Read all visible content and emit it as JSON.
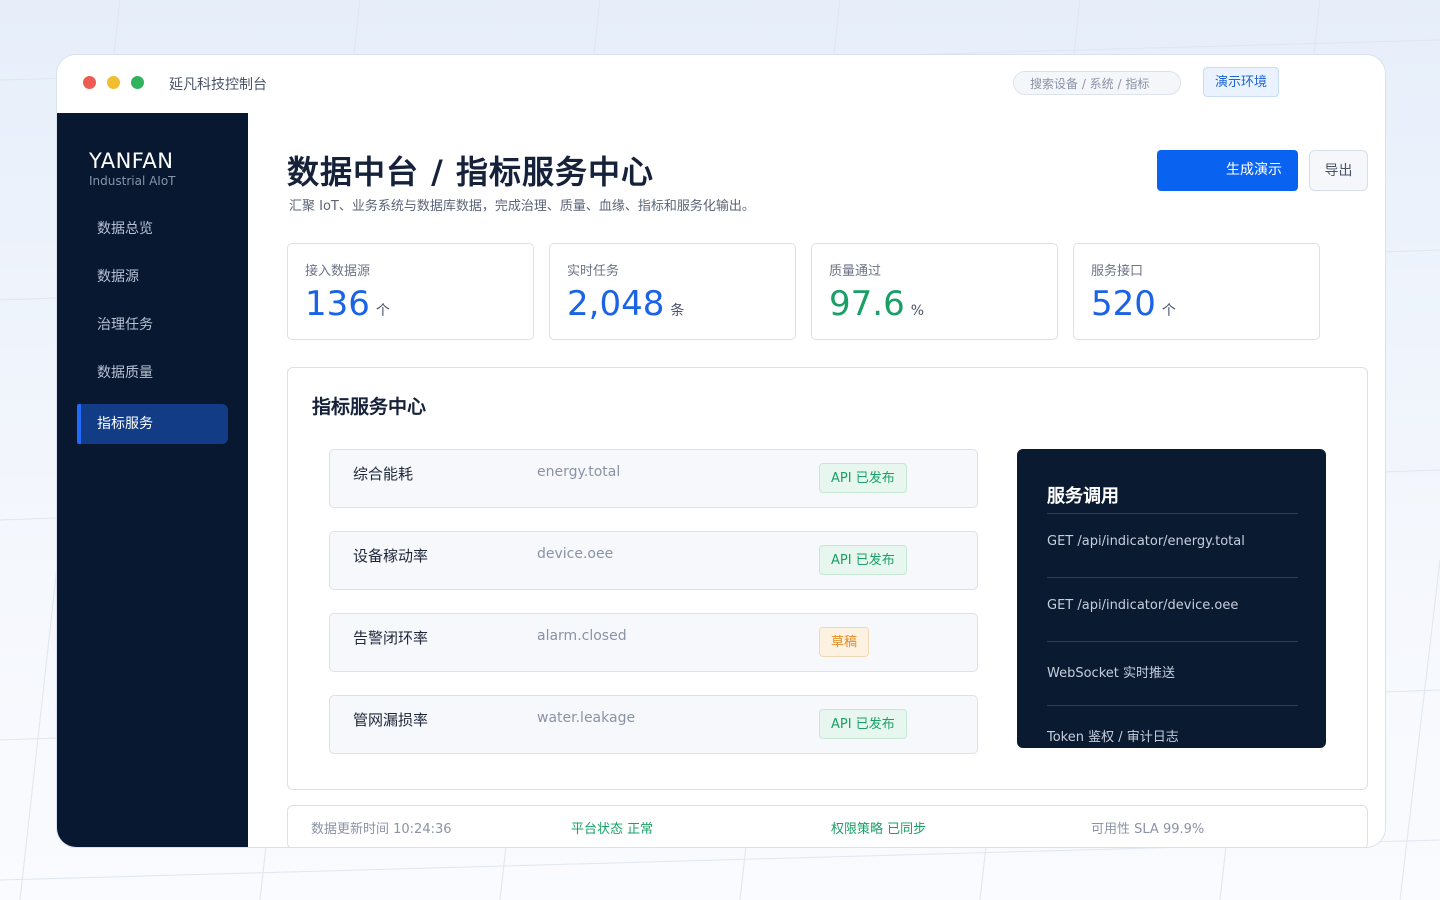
{
  "window": {
    "app_title": "延凡科技控制台",
    "search_placeholder": "搜索设备 / 系统 / 指标",
    "env_badge": "演示环境"
  },
  "sidebar": {
    "brand": "YANFAN",
    "brand_sub": "Industrial AIoT",
    "items": [
      {
        "label": "数据总览",
        "active": false
      },
      {
        "label": "数据源",
        "active": false
      },
      {
        "label": "治理任务",
        "active": false
      },
      {
        "label": "数据质量",
        "active": false
      },
      {
        "label": "指标服务",
        "active": true
      }
    ]
  },
  "header": {
    "title": "数据中台 / 指标服务中心",
    "description": "汇聚 IoT、业务系统与数据库数据，完成治理、质量、血缘、指标和服务化输出。",
    "primary_button": "生成演示",
    "export_button": "导出"
  },
  "stats": [
    {
      "label": "接入数据源",
      "value": "136",
      "unit": "个",
      "color": "#1a63e6"
    },
    {
      "label": "实时任务",
      "value": "2,048",
      "unit": "条",
      "color": "#1a63e6"
    },
    {
      "label": "质量通过",
      "value": "97.6",
      "unit": "%",
      "color": "#1aa067"
    },
    {
      "label": "服务接口",
      "value": "520",
      "unit": "个",
      "color": "#1a63e6"
    }
  ],
  "panel": {
    "title": "指标服务中心",
    "indicators": [
      {
        "name": "综合能耗",
        "code": "energy.total",
        "status": "API 已发布",
        "status_type": "published"
      },
      {
        "name": "设备稼动率",
        "code": "device.oee",
        "status": "API 已发布",
        "status_type": "published"
      },
      {
        "name": "告警闭环率",
        "code": "alarm.closed",
        "status": "草稿",
        "status_type": "draft"
      },
      {
        "name": "管网漏损率",
        "code": "water.leakage",
        "status": "API 已发布",
        "status_type": "published"
      }
    ],
    "service": {
      "title": "服务调用",
      "items": [
        "GET /api/indicator/energy.total",
        "GET /api/indicator/device.oee",
        "WebSocket 实时推送",
        "Token 鉴权 / 审计日志"
      ]
    }
  },
  "status_bar": {
    "update_time": "数据更新时间 10:24:36",
    "platform_status": "平台状态 正常",
    "permission": "权限策略 已同步",
    "sla": "可用性 SLA 99.9%"
  }
}
